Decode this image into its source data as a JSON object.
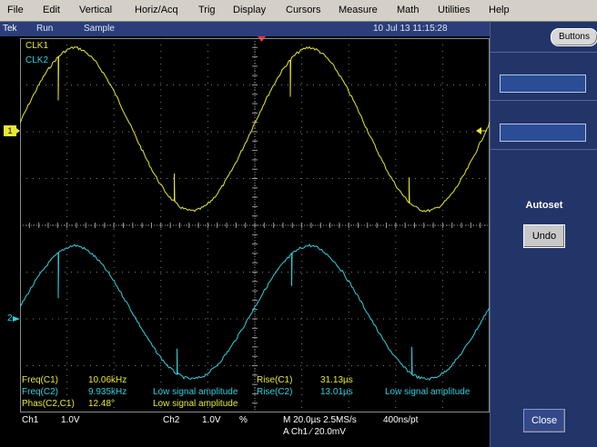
{
  "menu": [
    "File",
    "Edit",
    "Vertical",
    "Horiz/Acq",
    "Trig",
    "Display",
    "Cursors",
    "Measure",
    "Math",
    "Utilities",
    "Help"
  ],
  "status": {
    "brand": "Tek",
    "run": "Run",
    "mode": "Sample",
    "datetime": "10 Jul 13 11:15:28"
  },
  "right_panel": {
    "buttons_label": "Buttons",
    "autoset_label": "Autoset",
    "undo_label": "Undo",
    "close_label": "Close"
  },
  "waveform_labels": {
    "ch1": "CLK1",
    "ch2": "CLK2"
  },
  "markers": {
    "ch1": "1",
    "ch2": "2"
  },
  "measurements": {
    "freq_c1_label": "Freq(C1)",
    "freq_c1_value": "10.06kHz",
    "freq_c2_label": "Freq(C2)",
    "freq_c2_value": "9.935kHz",
    "freq_c2_note": "Low signal amplitude",
    "phas_label": "Phas(C2,C1)",
    "phas_value": "12.48°",
    "phas_note": "Low signal amplitude",
    "rise_c1_label": "Rise(C1)",
    "rise_c1_value": "31.13µs",
    "rise_c2_label": "Rise(C2)",
    "rise_c2_value": "13.01µs",
    "rise_c2_note": "Low signal amplitude"
  },
  "readouts": {
    "ch1_name": "Ch1",
    "ch1_scale": "1.0V",
    "ch2_name": "Ch2",
    "ch2_scale": "1.0V",
    "ch2_unit": "%",
    "timebase": "M 20.0µs 2.5MS/s",
    "record": "400ns/pt",
    "trigger": "A  Ch1  ⁄  20.0mV"
  },
  "colors": {
    "ch1": "#e8e830",
    "ch2": "#30d0e0",
    "panel": "#223568",
    "status": "#2b3e7a"
  }
}
